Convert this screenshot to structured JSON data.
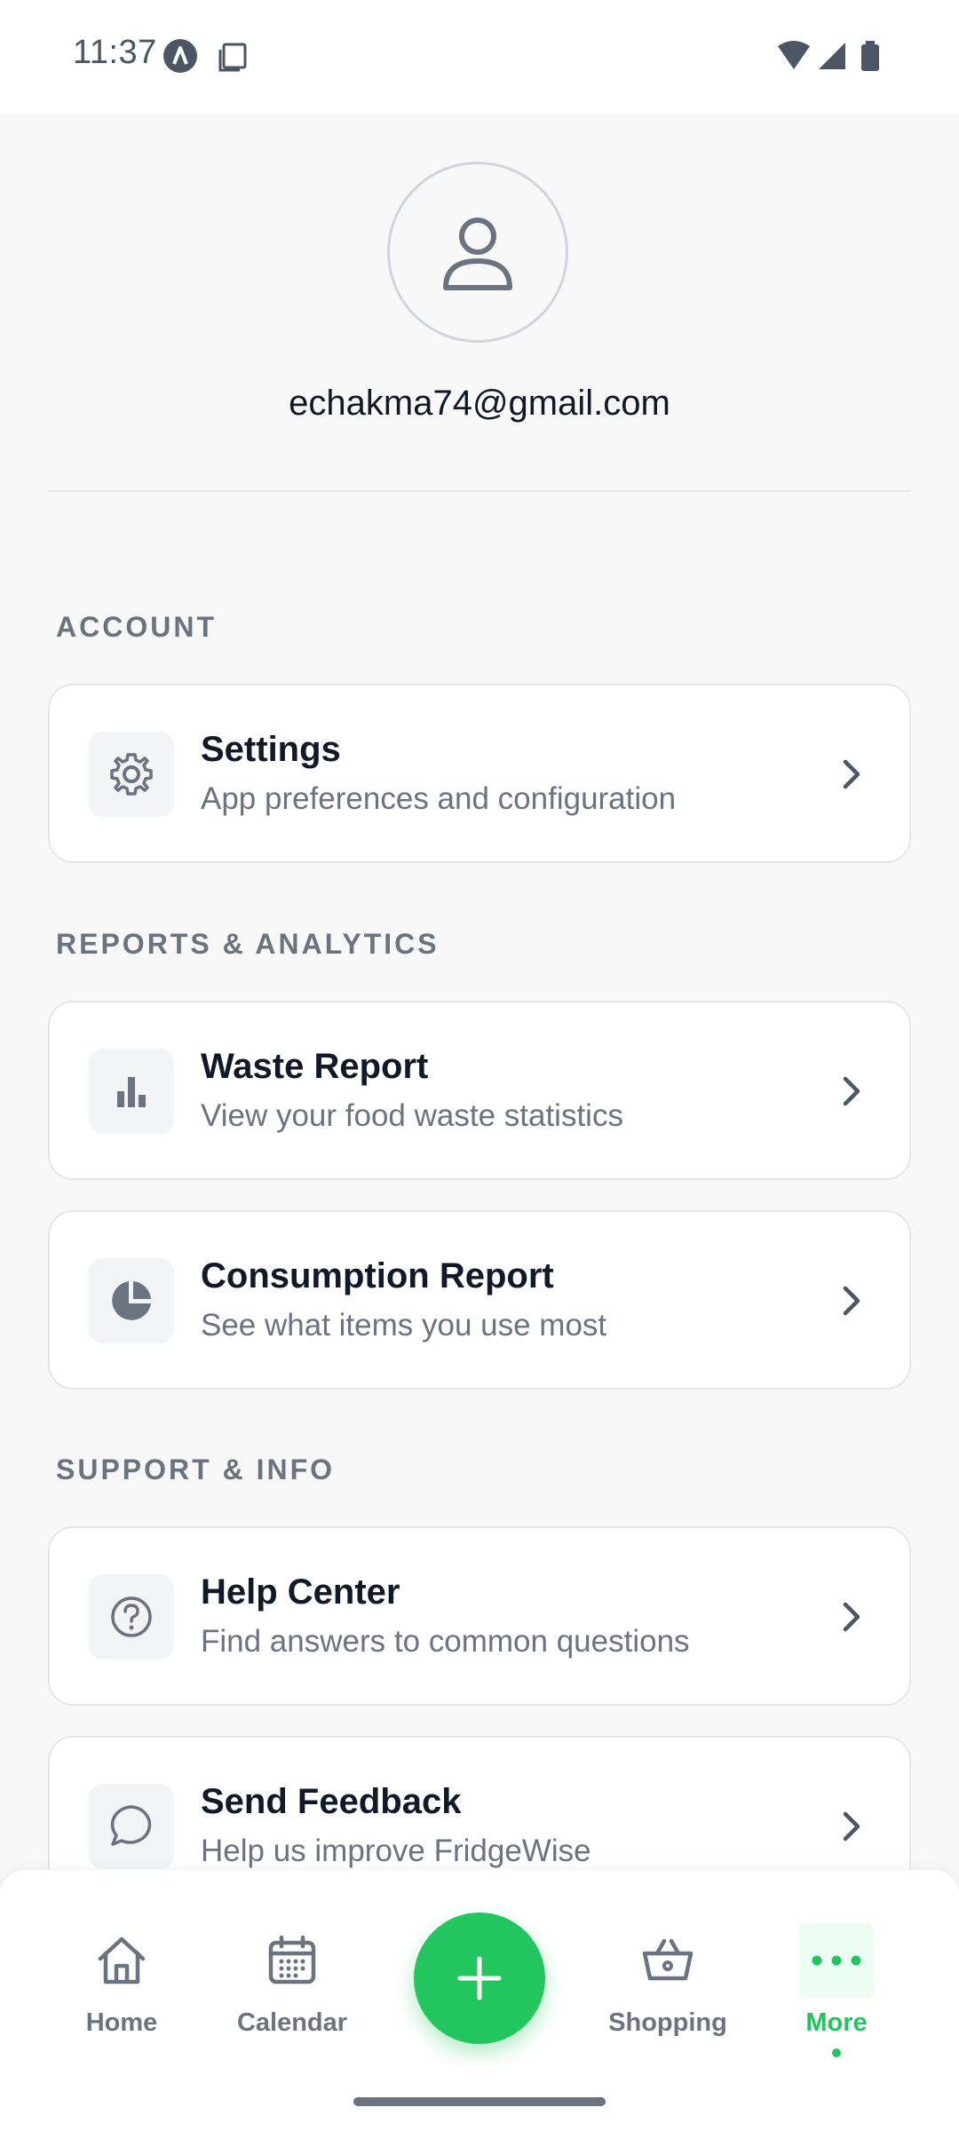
{
  "status_bar": {
    "time": "11:37"
  },
  "profile": {
    "email": "echakma74@gmail.com"
  },
  "sections": {
    "account": {
      "label": "ACCOUNT",
      "items": [
        {
          "title": "Settings",
          "subtitle": "App preferences and configuration",
          "icon": "gear-icon"
        }
      ]
    },
    "reports": {
      "label": "REPORTS & ANALYTICS",
      "items": [
        {
          "title": "Waste Report",
          "subtitle": "View your food waste statistics",
          "icon": "bar-chart-icon"
        },
        {
          "title": "Consumption Report",
          "subtitle": "See what items you use most",
          "icon": "pie-chart-icon"
        }
      ]
    },
    "support": {
      "label": "SUPPORT & INFO",
      "items": [
        {
          "title": "Help Center",
          "subtitle": "Find answers to common questions",
          "icon": "question-circle-icon"
        },
        {
          "title": "Send Feedback",
          "subtitle": "Help us improve FridgeWise",
          "icon": "chat-bubble-icon"
        }
      ]
    }
  },
  "bottom_nav": {
    "items": [
      {
        "label": "Home",
        "icon": "home-icon"
      },
      {
        "label": "Calendar",
        "icon": "calendar-icon"
      },
      {
        "label": "Shopping",
        "icon": "basket-icon"
      },
      {
        "label": "More",
        "icon": "more-dots-icon",
        "active": true
      }
    ],
    "fab_icon": "plus-icon"
  },
  "colors": {
    "accent": "#22c55e",
    "background": "#f8f8f8",
    "card": "#ffffff",
    "muted_text": "#6b7280",
    "primary_text": "#111827"
  }
}
